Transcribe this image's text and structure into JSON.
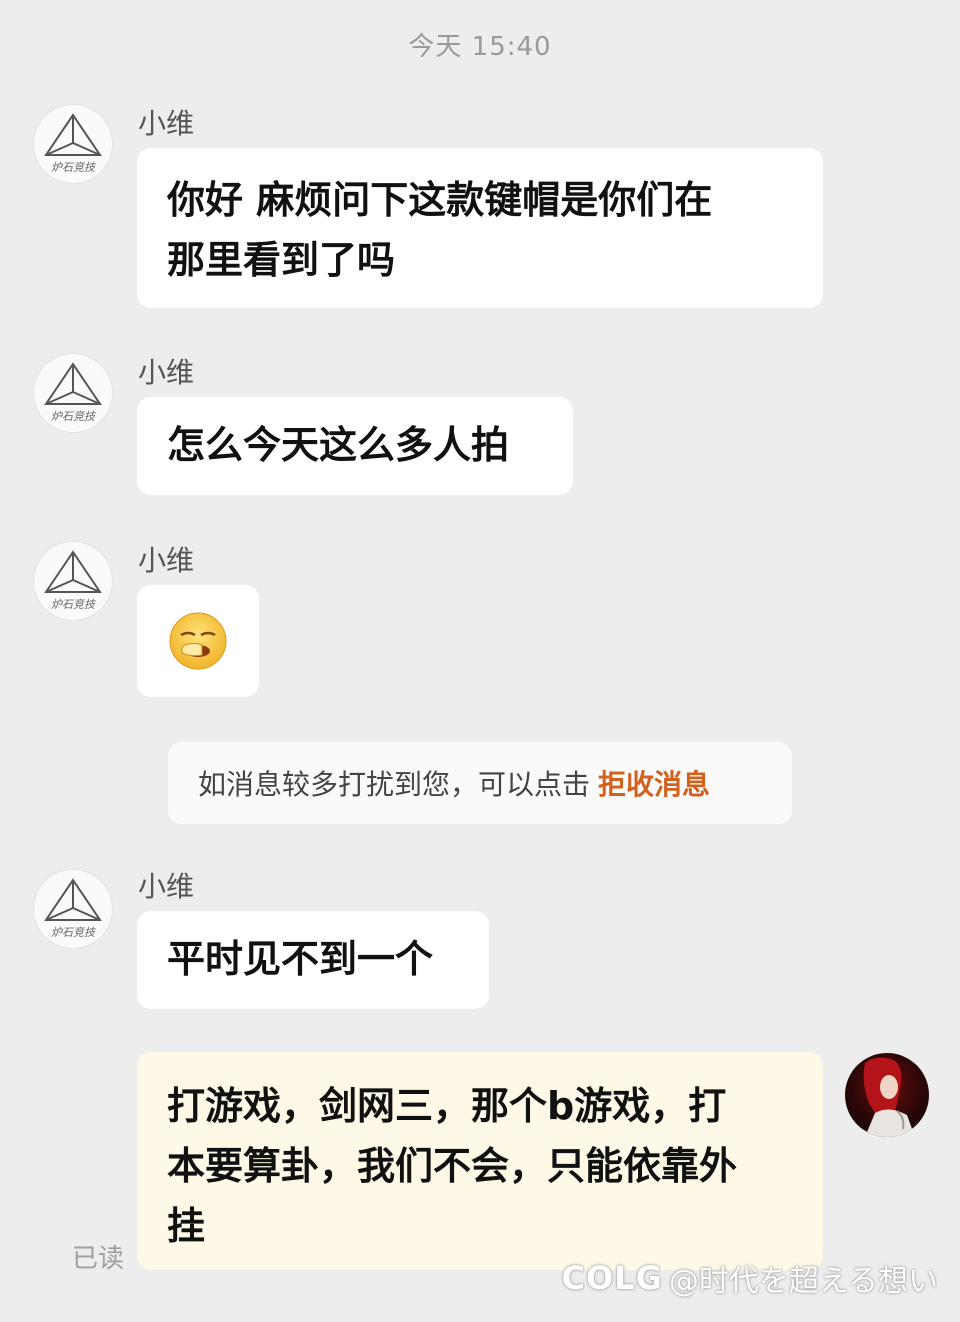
{
  "timestamp": "今天 15:40",
  "contact": {
    "name": "小维",
    "avatar_caption": "炉石竞技"
  },
  "messages": [
    {
      "sender": "小维",
      "text_line1": "你好  麻烦问下这款键帽是你们在",
      "text_line2": "那里看到了吗"
    },
    {
      "sender": "小维",
      "text": "怎么今天这么多人拍"
    },
    {
      "sender": "小维",
      "emoji": "yawning-face"
    },
    {
      "sender": "小维",
      "text": "平时见不到一个"
    },
    {
      "sender": "me",
      "text_line1": "打游戏，剑网三，那个b游戏，打",
      "text_line2": "本要算卦，我们不会，只能依靠外",
      "text_line3": "挂"
    }
  ],
  "notice": {
    "text": "如消息较多打扰到您，可以点击",
    "link": "拒收消息"
  },
  "read_status": "已读",
  "watermark": {
    "brand": "COLG",
    "handle": "@时代を超える想い"
  },
  "colors": {
    "background": "#ededed",
    "bubble_other": "#ffffff",
    "bubble_mine": "#fdf9e6",
    "notice_link": "#d2611d"
  }
}
